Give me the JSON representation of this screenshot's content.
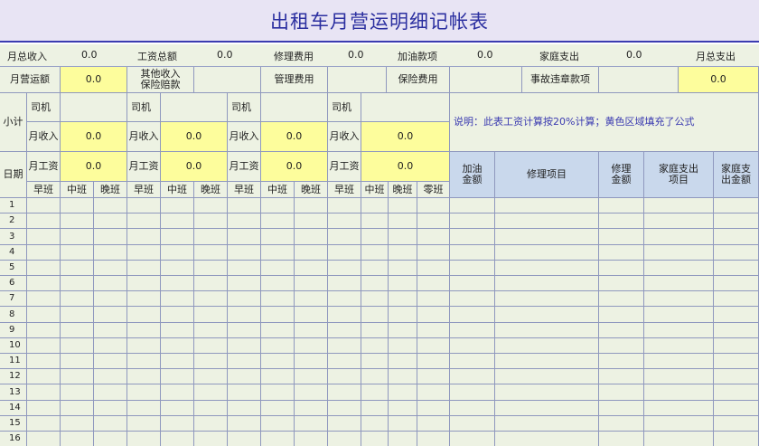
{
  "title": "出租车月营运明细记帐表",
  "summary": [
    {
      "label": "月总收入",
      "value": "0.0"
    },
    {
      "label": "工资总额",
      "value": "0.0"
    },
    {
      "label": "修理费用",
      "value": "0.0"
    },
    {
      "label": "加油款项",
      "value": "0.0"
    },
    {
      "label": "家庭支出",
      "value": "0.0"
    },
    {
      "label": "月总支出",
      "value": ""
    }
  ],
  "row2": {
    "monthly_op_label": "月营运额",
    "monthly_op_value": "0.0",
    "other_income_label": "其他收入\n保险赔款",
    "management_label": "管理费用",
    "insurance_label": "保险费用",
    "accident_label": "事故违章款项",
    "total_value": "0.0"
  },
  "subtotal_label": "小计",
  "date_label": "日期",
  "driver_label": "司机",
  "monthly_income_label": "月收入",
  "monthly_wage_label": "月工资",
  "drivers": [
    {
      "income": "0.0",
      "wage": "0.0"
    },
    {
      "income": "0.0",
      "wage": "0.0"
    },
    {
      "income": "0.0",
      "wage": "0.0"
    },
    {
      "income": "0.0",
      "wage": "0.0"
    }
  ],
  "note": "说明：此表工资计算按20%计算；黄色区域填充了公式",
  "shifts": [
    "早班",
    "中班",
    "晚班",
    "早班",
    "中班",
    "晚班",
    "早班",
    "中班",
    "晚班",
    "早班",
    "中班",
    "晚班",
    "零班"
  ],
  "right_headers": [
    "加油\n金额",
    "修理项目",
    "修理\n金额",
    "家庭支出\n项目",
    "家庭支\n出金额"
  ],
  "days": [
    "1",
    "2",
    "3",
    "4",
    "5",
    "6",
    "7",
    "8",
    "9",
    "10",
    "11",
    "12",
    "13",
    "14",
    "15",
    "16"
  ]
}
